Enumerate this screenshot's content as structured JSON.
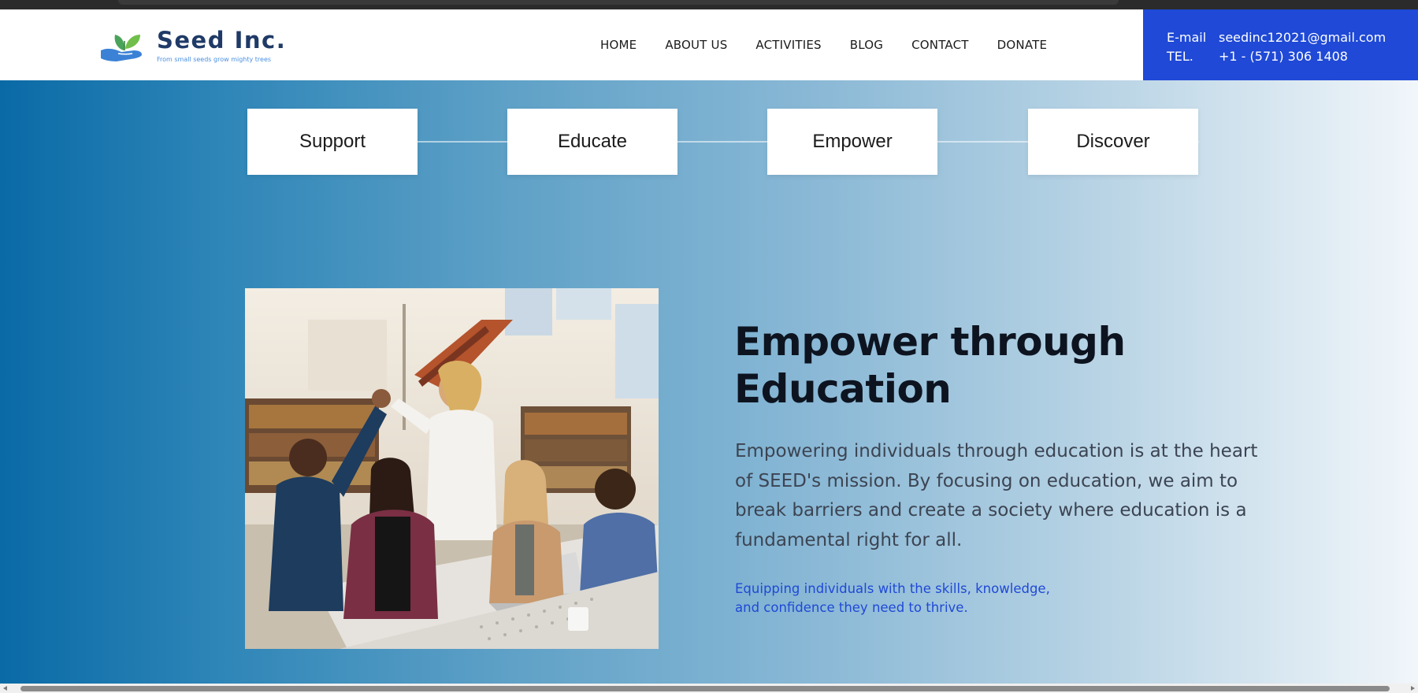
{
  "header": {
    "logo": {
      "title": "Seed Inc.",
      "tagline": "From small seeds grow mighty trees",
      "icon": "seedling-hand-icon"
    },
    "nav": [
      {
        "label": "HOME"
      },
      {
        "label": "ABOUT US"
      },
      {
        "label": "ACTIVITIES"
      },
      {
        "label": "BLOG"
      },
      {
        "label": "CONTACT"
      },
      {
        "label": "DONATE"
      }
    ],
    "contact": {
      "email_label": "E-mail",
      "email": "seedinc12021@gmail.com",
      "tel_label": "TEL.",
      "tel": "+1 - (571) 306 1408"
    }
  },
  "steps": [
    {
      "label": "Support"
    },
    {
      "label": "Educate"
    },
    {
      "label": "Empower"
    },
    {
      "label": "Discover"
    }
  ],
  "hero": {
    "headline_line1": "Empower through",
    "headline_line2": "Education",
    "body": "Empowering individuals through education is at the heart of SEED's mission. By focusing on education, we aim to break barriers and create a society where education is a fundamental right for all.",
    "sub_line1": "Equipping individuals with the skills, knowledge,",
    "sub_line2": "and confidence they need to thrive.",
    "image": "group-high-five-library-photo"
  },
  "colors": {
    "brand_blue": "#1f49d6",
    "logo_navy": "#1f3a67",
    "gradient_start": "#0a6aa6",
    "gradient_end": "#f1f6fa"
  }
}
